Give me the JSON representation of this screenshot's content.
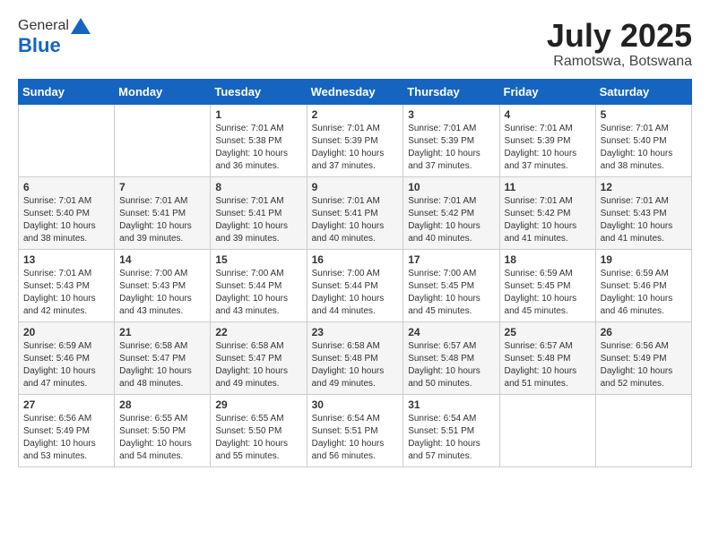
{
  "logo": {
    "line1": "General",
    "line2": "Blue"
  },
  "title": "July 2025",
  "subtitle": "Ramotswa, Botswana",
  "days_of_week": [
    "Sunday",
    "Monday",
    "Tuesday",
    "Wednesday",
    "Thursday",
    "Friday",
    "Saturday"
  ],
  "weeks": [
    [
      {
        "day": "",
        "detail": ""
      },
      {
        "day": "",
        "detail": ""
      },
      {
        "day": "1",
        "detail": "Sunrise: 7:01 AM\nSunset: 5:38 PM\nDaylight: 10 hours and 36 minutes."
      },
      {
        "day": "2",
        "detail": "Sunrise: 7:01 AM\nSunset: 5:39 PM\nDaylight: 10 hours and 37 minutes."
      },
      {
        "day": "3",
        "detail": "Sunrise: 7:01 AM\nSunset: 5:39 PM\nDaylight: 10 hours and 37 minutes."
      },
      {
        "day": "4",
        "detail": "Sunrise: 7:01 AM\nSunset: 5:39 PM\nDaylight: 10 hours and 37 minutes."
      },
      {
        "day": "5",
        "detail": "Sunrise: 7:01 AM\nSunset: 5:40 PM\nDaylight: 10 hours and 38 minutes."
      }
    ],
    [
      {
        "day": "6",
        "detail": "Sunrise: 7:01 AM\nSunset: 5:40 PM\nDaylight: 10 hours and 38 minutes."
      },
      {
        "day": "7",
        "detail": "Sunrise: 7:01 AM\nSunset: 5:41 PM\nDaylight: 10 hours and 39 minutes."
      },
      {
        "day": "8",
        "detail": "Sunrise: 7:01 AM\nSunset: 5:41 PM\nDaylight: 10 hours and 39 minutes."
      },
      {
        "day": "9",
        "detail": "Sunrise: 7:01 AM\nSunset: 5:41 PM\nDaylight: 10 hours and 40 minutes."
      },
      {
        "day": "10",
        "detail": "Sunrise: 7:01 AM\nSunset: 5:42 PM\nDaylight: 10 hours and 40 minutes."
      },
      {
        "day": "11",
        "detail": "Sunrise: 7:01 AM\nSunset: 5:42 PM\nDaylight: 10 hours and 41 minutes."
      },
      {
        "day": "12",
        "detail": "Sunrise: 7:01 AM\nSunset: 5:43 PM\nDaylight: 10 hours and 41 minutes."
      }
    ],
    [
      {
        "day": "13",
        "detail": "Sunrise: 7:01 AM\nSunset: 5:43 PM\nDaylight: 10 hours and 42 minutes."
      },
      {
        "day": "14",
        "detail": "Sunrise: 7:00 AM\nSunset: 5:43 PM\nDaylight: 10 hours and 43 minutes."
      },
      {
        "day": "15",
        "detail": "Sunrise: 7:00 AM\nSunset: 5:44 PM\nDaylight: 10 hours and 43 minutes."
      },
      {
        "day": "16",
        "detail": "Sunrise: 7:00 AM\nSunset: 5:44 PM\nDaylight: 10 hours and 44 minutes."
      },
      {
        "day": "17",
        "detail": "Sunrise: 7:00 AM\nSunset: 5:45 PM\nDaylight: 10 hours and 45 minutes."
      },
      {
        "day": "18",
        "detail": "Sunrise: 6:59 AM\nSunset: 5:45 PM\nDaylight: 10 hours and 45 minutes."
      },
      {
        "day": "19",
        "detail": "Sunrise: 6:59 AM\nSunset: 5:46 PM\nDaylight: 10 hours and 46 minutes."
      }
    ],
    [
      {
        "day": "20",
        "detail": "Sunrise: 6:59 AM\nSunset: 5:46 PM\nDaylight: 10 hours and 47 minutes."
      },
      {
        "day": "21",
        "detail": "Sunrise: 6:58 AM\nSunset: 5:47 PM\nDaylight: 10 hours and 48 minutes."
      },
      {
        "day": "22",
        "detail": "Sunrise: 6:58 AM\nSunset: 5:47 PM\nDaylight: 10 hours and 49 minutes."
      },
      {
        "day": "23",
        "detail": "Sunrise: 6:58 AM\nSunset: 5:48 PM\nDaylight: 10 hours and 49 minutes."
      },
      {
        "day": "24",
        "detail": "Sunrise: 6:57 AM\nSunset: 5:48 PM\nDaylight: 10 hours and 50 minutes."
      },
      {
        "day": "25",
        "detail": "Sunrise: 6:57 AM\nSunset: 5:48 PM\nDaylight: 10 hours and 51 minutes."
      },
      {
        "day": "26",
        "detail": "Sunrise: 6:56 AM\nSunset: 5:49 PM\nDaylight: 10 hours and 52 minutes."
      }
    ],
    [
      {
        "day": "27",
        "detail": "Sunrise: 6:56 AM\nSunset: 5:49 PM\nDaylight: 10 hours and 53 minutes."
      },
      {
        "day": "28",
        "detail": "Sunrise: 6:55 AM\nSunset: 5:50 PM\nDaylight: 10 hours and 54 minutes."
      },
      {
        "day": "29",
        "detail": "Sunrise: 6:55 AM\nSunset: 5:50 PM\nDaylight: 10 hours and 55 minutes."
      },
      {
        "day": "30",
        "detail": "Sunrise: 6:54 AM\nSunset: 5:51 PM\nDaylight: 10 hours and 56 minutes."
      },
      {
        "day": "31",
        "detail": "Sunrise: 6:54 AM\nSunset: 5:51 PM\nDaylight: 10 hours and 57 minutes."
      },
      {
        "day": "",
        "detail": ""
      },
      {
        "day": "",
        "detail": ""
      }
    ]
  ]
}
